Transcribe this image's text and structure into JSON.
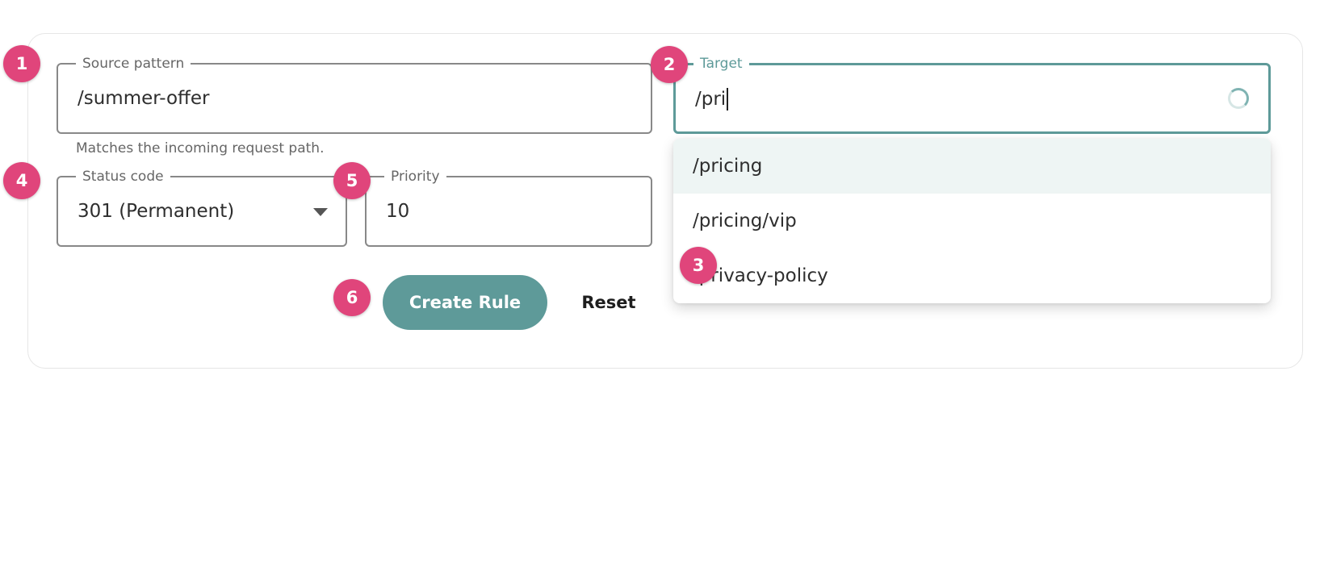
{
  "form": {
    "source": {
      "label": "Source pattern",
      "value": "/summer-offer",
      "helper": "Matches the incoming request path."
    },
    "target": {
      "label": "Target",
      "value": "/pri",
      "suggestions": [
        "/pricing",
        "/pricing/vip",
        "/privacy-policy"
      ]
    },
    "status": {
      "label": "Status code",
      "value": "301 (Permanent)"
    },
    "priority": {
      "label": "Priority",
      "value": "10"
    },
    "actions": {
      "create_label": "Create Rule",
      "reset_label": "Reset"
    }
  },
  "markers": [
    "1",
    "2",
    "3",
    "4",
    "5",
    "6"
  ],
  "colors": {
    "accent": "#5e9a99",
    "marker": "#e0457b",
    "highlight": "#eef5f4"
  },
  "icons": {
    "status_dropdown": "chevron-down-icon",
    "target_loading": "loading-spinner-icon"
  }
}
